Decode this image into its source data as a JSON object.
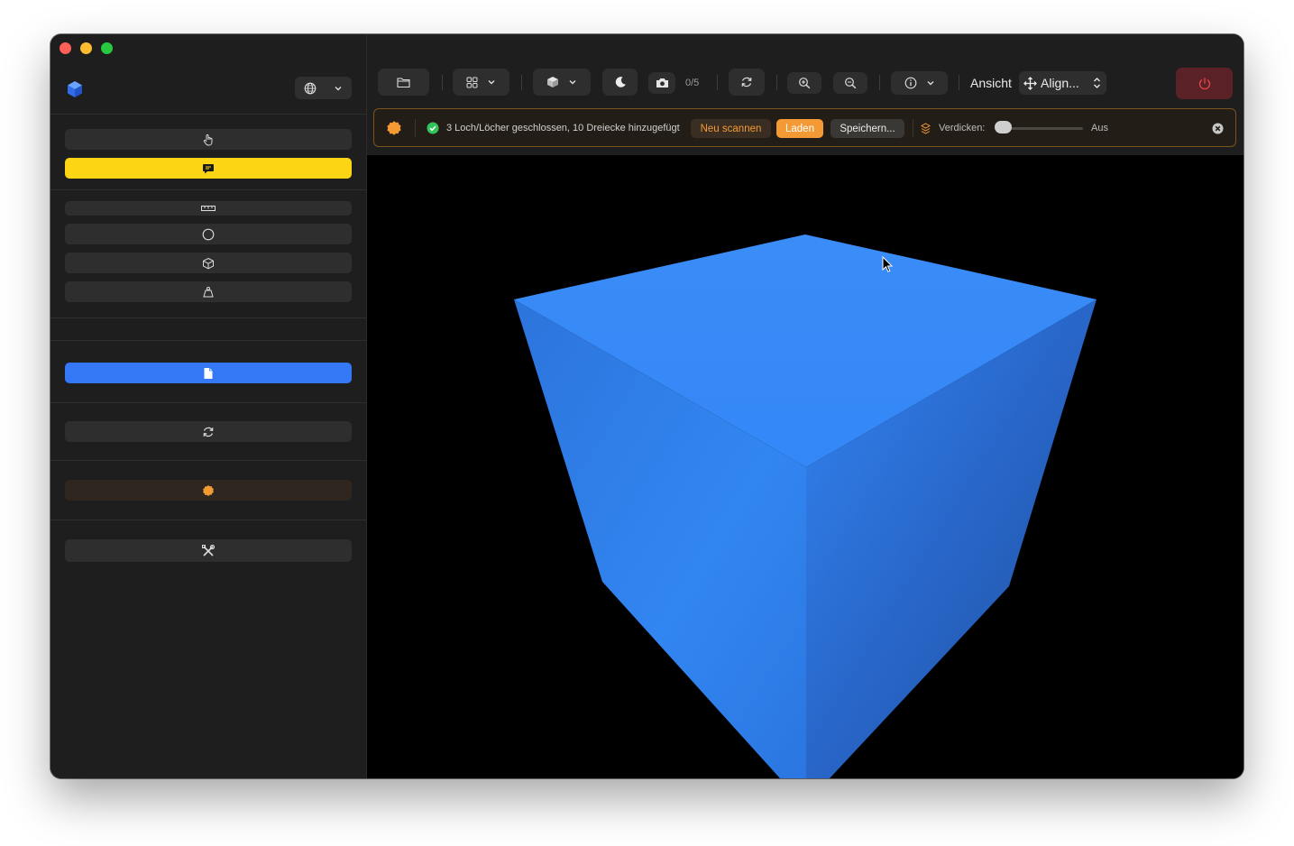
{
  "window": {
    "traffic_lights": [
      "close",
      "minimize",
      "zoom"
    ]
  },
  "sidebar": {
    "logo_icon": "cube-logo-icon",
    "language_icon": "globe-icon",
    "buttons": [
      {
        "icon": "pointer-hand-icon",
        "active": false
      },
      {
        "icon": "comment-icon",
        "active": true,
        "color": "#fcd614"
      },
      {
        "icon": "ruler-icon",
        "active": false
      },
      {
        "icon": "circle-icon",
        "active": false
      },
      {
        "icon": "cube-outline-icon",
        "active": false
      },
      {
        "icon": "weight-icon",
        "active": false
      },
      {
        "icon": "document-icon",
        "active": true,
        "color": "#3478f6"
      },
      {
        "icon": "refresh-icon",
        "active": false
      },
      {
        "icon": "badge-icon",
        "color": "#f39a35"
      },
      {
        "icon": "tools-icon",
        "active": false
      }
    ]
  },
  "toolbar": {
    "snapshot_counter": "0/5",
    "view_label": "Ansicht",
    "align_select": "Align...",
    "power_color": "#e0434b"
  },
  "infobar": {
    "status_text": "3 Loch/Löcher geschlossen, 10 Dreiecke hinzugefügt",
    "rescan_button": "Neu scannen",
    "load_button": "Laden",
    "save_button": "Speichern...",
    "thicken_label": "Verdicken:",
    "thicken_value": "Aus",
    "thicken_slider_fraction": 0.0,
    "accent_color": "#f39a35"
  },
  "viewport": {
    "model_color": "#3487f7",
    "background": "#000000"
  }
}
